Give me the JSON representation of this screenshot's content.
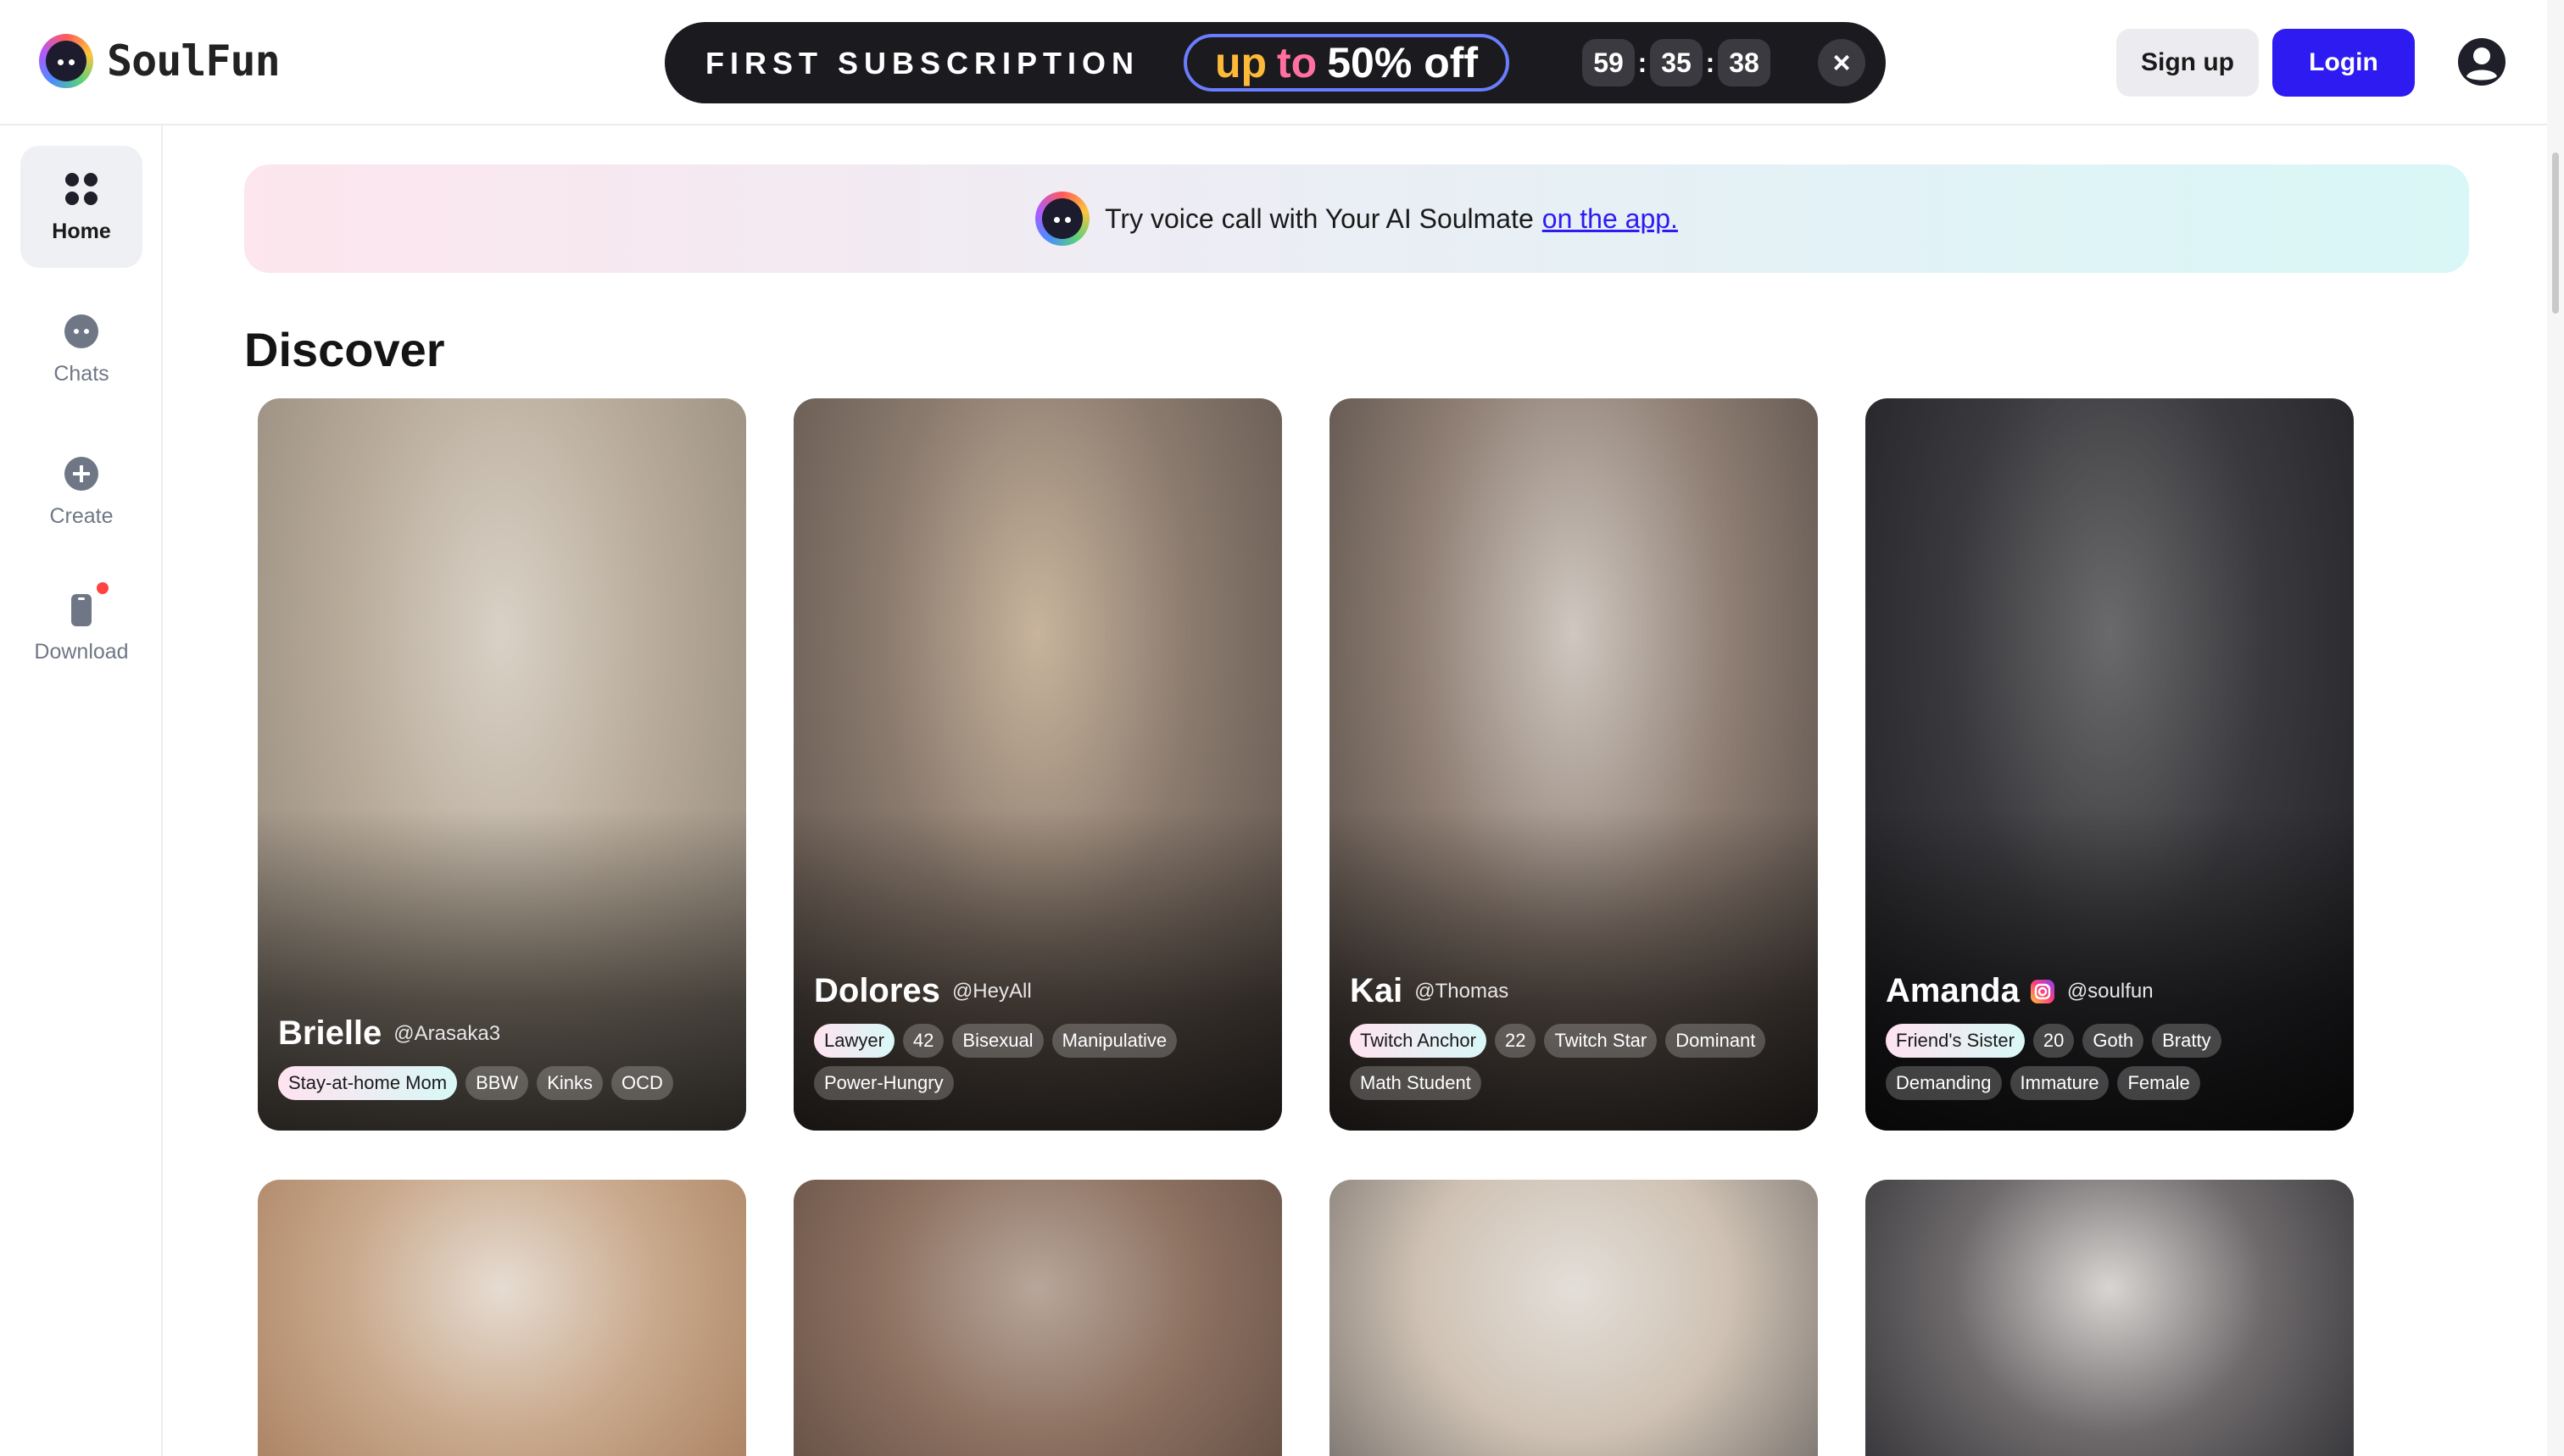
{
  "app": {
    "name": "SoulFun"
  },
  "promo": {
    "title": "FIRST SUBSCRIPTION",
    "offer_up": "up",
    "offer_to": "to",
    "offer_pct": "50% off",
    "countdown": {
      "hours": "59",
      "minutes": "35",
      "seconds": "38"
    },
    "close": "×"
  },
  "auth": {
    "signup": "Sign up",
    "login": "Login"
  },
  "sidebar": {
    "items": [
      {
        "label": "Home",
        "icon": "grid-icon"
      },
      {
        "label": "Chats",
        "icon": "chat-bubble-icon"
      },
      {
        "label": "Create",
        "icon": "plus-circle-icon"
      },
      {
        "label": "Download",
        "icon": "phone-icon"
      }
    ]
  },
  "banner": {
    "text": "Try voice call with Your AI Soulmate",
    "link": "on the app."
  },
  "discover": {
    "title": "Discover",
    "cards": [
      {
        "name": "Brielle",
        "handle": "@Arasaka3",
        "tags": [
          "Stay-at-home Mom",
          "BBW",
          "Kinks",
          "OCD"
        ],
        "colors": [
          "#d9d1c6",
          "#b8ab9a",
          "#8f8478"
        ]
      },
      {
        "name": "Dolores",
        "handle": "@HeyAll",
        "tags": [
          "Lawyer",
          "42",
          "Bisexual",
          "Manipulative",
          "Power-Hungry"
        ],
        "colors": [
          "#c8b49c",
          "#8a7a6e",
          "#5a4f48"
        ]
      },
      {
        "name": "Kai",
        "handle": "@Thomas",
        "tags": [
          "Twitch Anchor",
          "22",
          "Twitch Star",
          "Dominant",
          "Math Student"
        ],
        "colors": [
          "#cfc7c0",
          "#8f7f74",
          "#4e4540"
        ]
      },
      {
        "name": "Amanda",
        "handle": "@soulfun",
        "instagram": true,
        "tags": [
          "Friend's Sister",
          "20",
          "Goth",
          "Bratty",
          "Demanding",
          "Immature",
          "Female"
        ],
        "colors": [
          "#6a6a6c",
          "#3a3a3e",
          "#1e1e22"
        ]
      },
      {
        "name": "",
        "handle": "",
        "tags": [],
        "colors": [
          "#e6dcd2",
          "#c9a98c",
          "#a57a5a"
        ]
      },
      {
        "name": "",
        "handle": "",
        "tags": [],
        "colors": [
          "#b7a69a",
          "#8e7262",
          "#5e4a40"
        ]
      },
      {
        "name": "",
        "handle": "",
        "tags": [],
        "colors": [
          "#e3ded8",
          "#cfc2b4",
          "#6b6562"
        ]
      },
      {
        "name": "",
        "handle": "",
        "tags": [],
        "colors": [
          "#d9d5d2",
          "#6e6a6c",
          "#2a2a2e"
        ]
      }
    ]
  }
}
